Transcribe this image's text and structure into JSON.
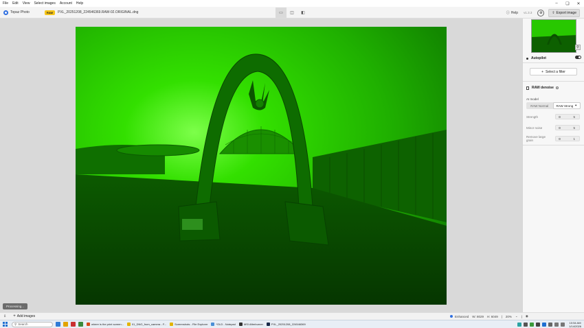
{
  "menu": [
    "File",
    "Edit",
    "View",
    "Select images",
    "Account",
    "Help"
  ],
  "app": {
    "name": "Topaz Photo"
  },
  "file": {
    "badge": "RAW",
    "name": "PXL_20251208_224546369.RAW-02.ORIGINAL.dng"
  },
  "header": {
    "help": "Help",
    "version": "v1.3.3",
    "export": "Export image"
  },
  "canvas": {
    "preview_label": "Processing..."
  },
  "side": {
    "autopilot": "Autopilot",
    "select_filter": "Select a filter",
    "raw_denoise": "RAW denoise",
    "ai_model_label": "AI model",
    "model_tabs": [
      "RAW Normal",
      "RAW Strong"
    ],
    "active_model": "RAW Strong",
    "sliders": [
      {
        "label": "Strength",
        "value": "5"
      },
      {
        "label": "Minor noise",
        "value": "5"
      },
      {
        "label": "Remove large grain",
        "value": "1"
      }
    ]
  },
  "bottom": {
    "add_images": "Add images",
    "status": "Enhanced",
    "dimension_w": "W: 8029",
    "dimension_h": "H: 6049",
    "zoom": "20%"
  },
  "taskbar": {
    "search": "Search",
    "apps": [
      "where is the print screen...",
      "01_DNG_from_camera - F...",
      "Screenshots - File Explorer",
      "*OLD - Notepad",
      "MSI Afterburner",
      "PXL_20251208_224546369"
    ],
    "time": "10:54 AM",
    "date": "1/14/2026"
  },
  "colors": {
    "photo_green": "#23c400",
    "accent_blue": "#2f6fe0",
    "badge_yellow": "#f5c518"
  }
}
